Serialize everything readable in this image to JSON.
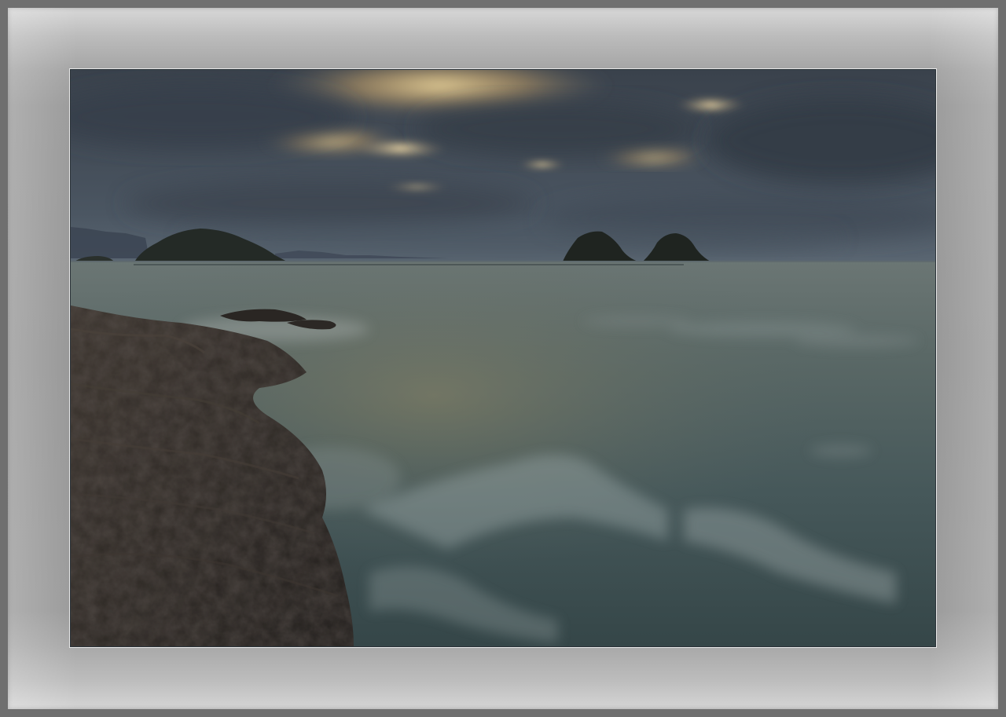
{
  "scene": {
    "subject": "seascape",
    "colors": {
      "frame": "#6f6f6f",
      "mat": "#969696",
      "sky_dark": "#2f3842",
      "sky_glow": "#e9c27a",
      "sea": "#4a5a5c",
      "rock": "#2e2a27"
    }
  }
}
